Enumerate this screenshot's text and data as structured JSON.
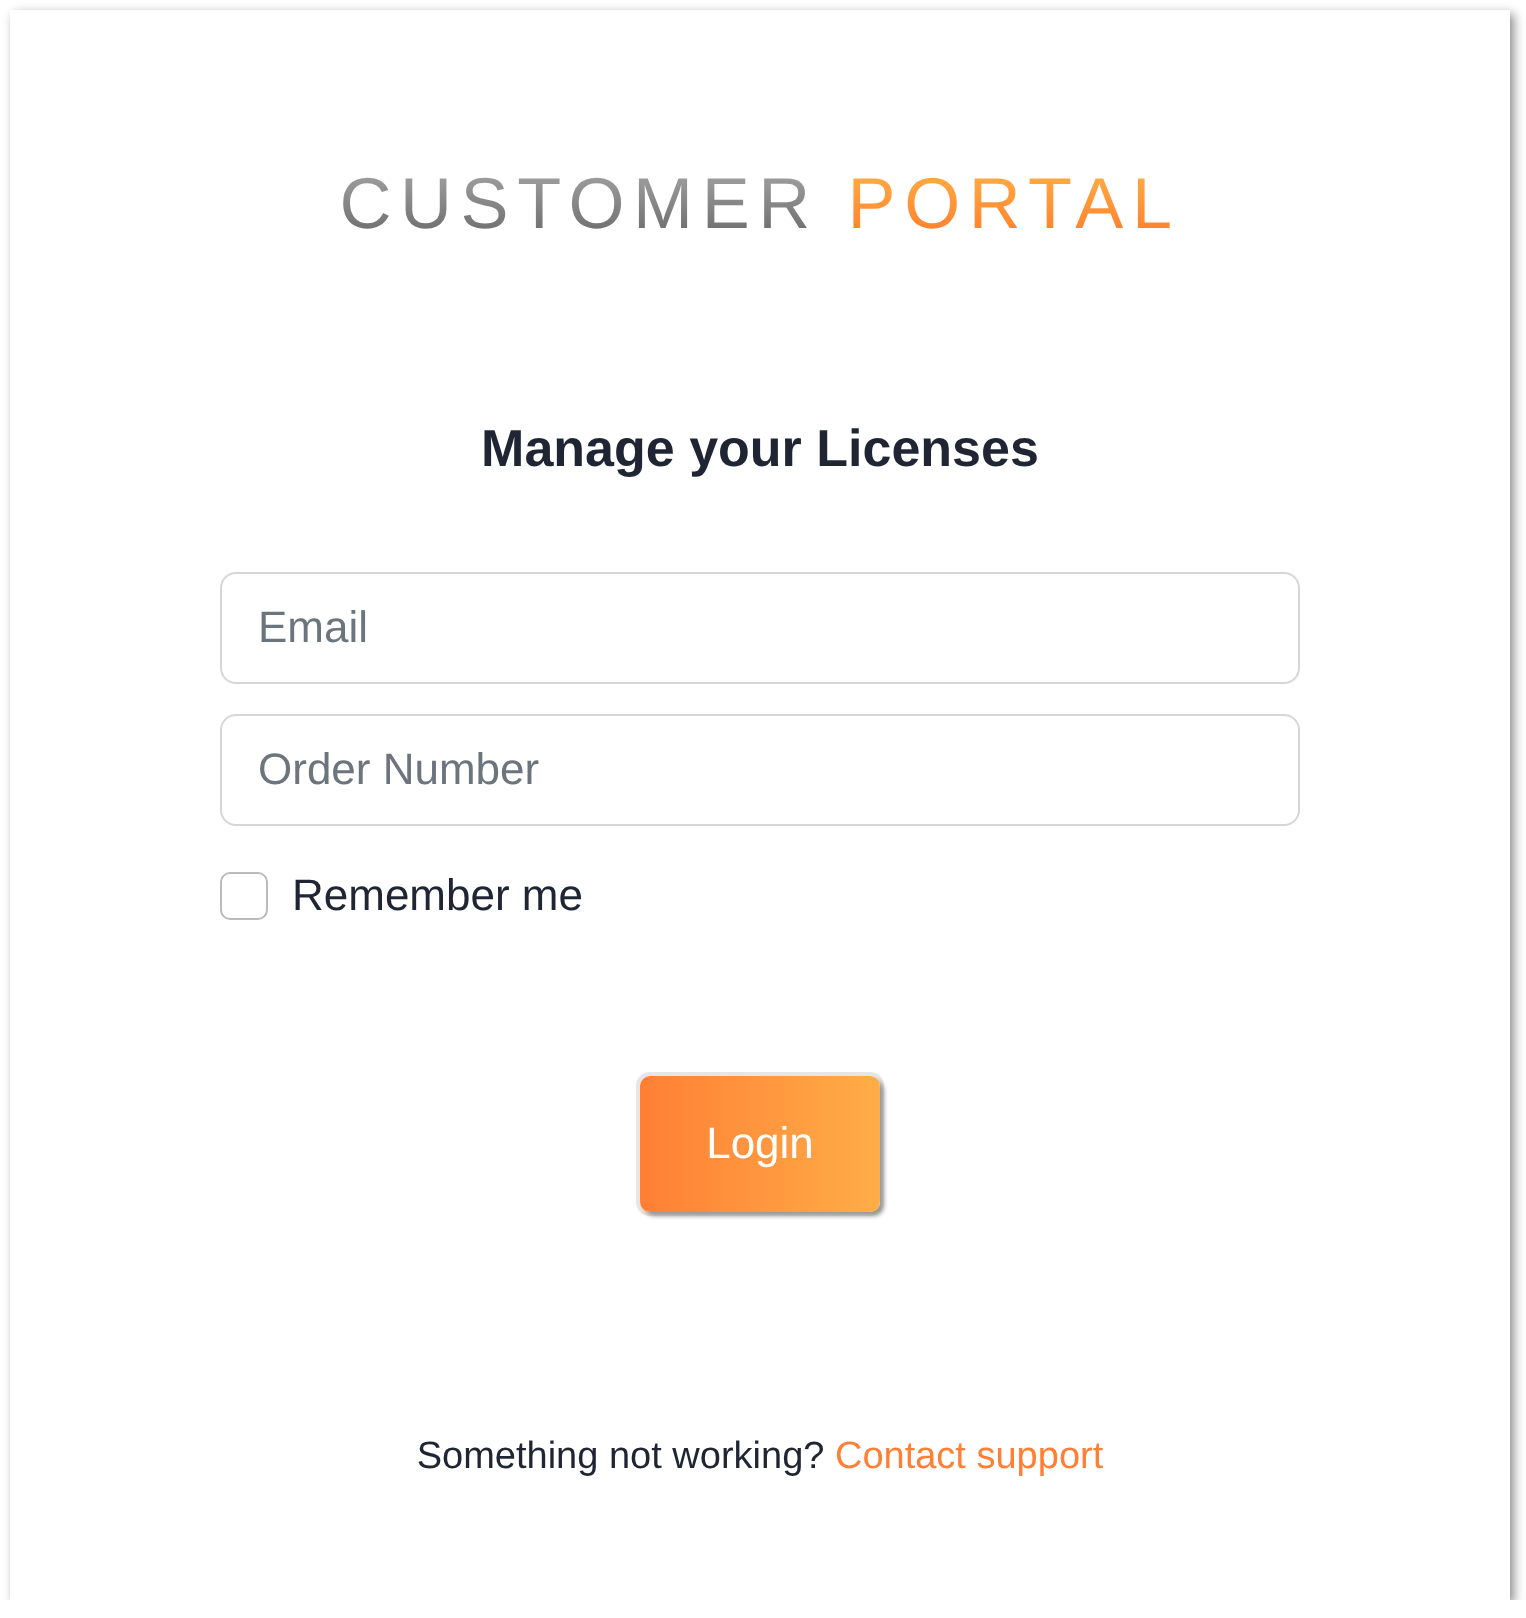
{
  "logo": {
    "primary": "CUSTOMER",
    "accent": "PORTAL"
  },
  "heading": "Manage your Licenses",
  "fields": [
    {
      "placeholder": "Email"
    },
    {
      "placeholder": "Order Number"
    }
  ],
  "remember": {
    "label": "Remember me",
    "checked": false
  },
  "login_button": "Login",
  "footer": {
    "text": "Something not working?",
    "link": "Contact support"
  }
}
